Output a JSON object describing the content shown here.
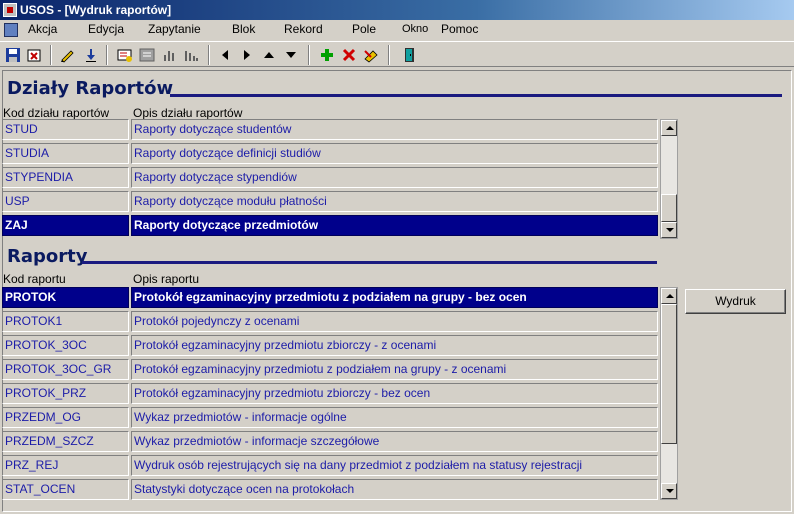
{
  "window": {
    "title": "USOS - [Wydruk raportów]"
  },
  "menu": {
    "items": [
      "Akcja",
      "Edycja",
      "Zapytanie",
      "Blok",
      "Rekord",
      "Pole",
      "Okno",
      "Pomoc"
    ]
  },
  "toolbar": {
    "icons": [
      "save-icon",
      "exit-icon",
      "edit-icon",
      "download-icon",
      "query-icon",
      "execute-query-icon",
      "chart-icon",
      "histogram-icon",
      "previous-block-icon",
      "next-block-icon",
      "previous-record-icon",
      "next-record-icon",
      "insert-record-icon",
      "delete-record-icon",
      "clear-record-icon",
      "exit-door-icon"
    ]
  },
  "dzialy": {
    "title": "Działy Raportów",
    "col_code": "Kod działu raportów",
    "col_desc": "Opis działu raportów",
    "rows": [
      {
        "code": "STUD",
        "desc": "Raporty dotyczące studentów"
      },
      {
        "code": "STUDIA",
        "desc": "Raporty dotyczące definicji studiów"
      },
      {
        "code": "STYPENDIA",
        "desc": "Raporty dotyczące stypendiów"
      },
      {
        "code": "USP",
        "desc": "Raporty dotyczące modułu płatności"
      },
      {
        "code": "ZAJ",
        "desc": "Raporty dotyczące przedmiotów"
      }
    ],
    "selected_index": 4
  },
  "raporty": {
    "title": "Raporty",
    "col_code": "Kod raportu",
    "col_desc": "Opis raportu",
    "rows": [
      {
        "code": "PROTOK",
        "desc": "Protokół egzaminacyjny przedmiotu z podziałem na grupy - bez ocen"
      },
      {
        "code": "PROTOK1",
        "desc": "Protokół pojedynczy z ocenami"
      },
      {
        "code": "PROTOK_3OC",
        "desc": "Protokół egzaminacyjny przedmiotu zbiorczy - z ocenami"
      },
      {
        "code": "PROTOK_3OC_GR",
        "desc": "Protokół egzaminacyjny przedmiotu z podziałem na grupy - z ocenami"
      },
      {
        "code": "PROTOK_PRZ",
        "desc": "Protokół egzaminacyjny przedmiotu zbiorczy - bez ocen"
      },
      {
        "code": "PRZEDM_OG",
        "desc": "Wykaz przedmiotów - informacje ogólne"
      },
      {
        "code": "PRZEDM_SZCZ",
        "desc": "Wykaz przedmiotów - informacje szczegółowe"
      },
      {
        "code": "PRZ_REJ",
        "desc": "Wydruk osób rejestrujących się na dany przedmiot z podziałem na statusy rejestracji"
      },
      {
        "code": "STAT_OCEN",
        "desc": "Statystyki dotyczące ocen na protokołach"
      }
    ],
    "selected_index": 0,
    "print_button": "Wydruk"
  }
}
